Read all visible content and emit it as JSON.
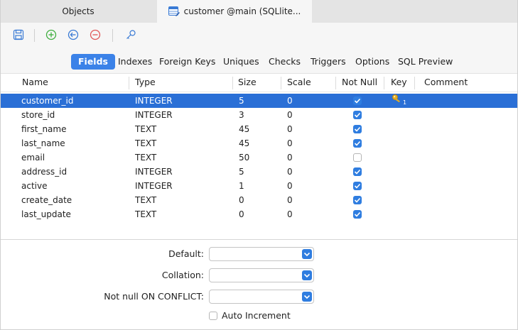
{
  "tabs": {
    "objects": "Objects",
    "active": "customer @main (SQLlite..."
  },
  "toolbar": {
    "icons": [
      "save-icon",
      "add-field-icon",
      "insert-field-icon",
      "delete-field-icon",
      "key-icon"
    ]
  },
  "subtabs": [
    "Fields",
    "Indexes",
    "Foreign Keys",
    "Uniques",
    "Checks",
    "Triggers",
    "Options",
    "SQL Preview"
  ],
  "grid": {
    "headers": {
      "name": "Name",
      "type": "Type",
      "size": "Size",
      "scale": "Scale",
      "not_null": "Not Null",
      "key": "Key",
      "comment": "Comment"
    },
    "rows": [
      {
        "name": "customer_id",
        "type": "INTEGER",
        "size": "5",
        "scale": "0",
        "not_null": true,
        "key": "1",
        "selected": true
      },
      {
        "name": "store_id",
        "type": "INTEGER",
        "size": "3",
        "scale": "0",
        "not_null": true,
        "key": "",
        "selected": false
      },
      {
        "name": "first_name",
        "type": "TEXT",
        "size": "45",
        "scale": "0",
        "not_null": true,
        "key": "",
        "selected": false
      },
      {
        "name": "last_name",
        "type": "TEXT",
        "size": "45",
        "scale": "0",
        "not_null": true,
        "key": "",
        "selected": false
      },
      {
        "name": "email",
        "type": "TEXT",
        "size": "50",
        "scale": "0",
        "not_null": false,
        "key": "",
        "selected": false
      },
      {
        "name": "address_id",
        "type": "INTEGER",
        "size": "5",
        "scale": "0",
        "not_null": true,
        "key": "",
        "selected": false
      },
      {
        "name": "active",
        "type": "INTEGER",
        "size": "1",
        "scale": "0",
        "not_null": true,
        "key": "",
        "selected": false
      },
      {
        "name": "create_date",
        "type": "TEXT",
        "size": "0",
        "scale": "0",
        "not_null": true,
        "key": "",
        "selected": false
      },
      {
        "name": "last_update",
        "type": "TEXT",
        "size": "0",
        "scale": "0",
        "not_null": true,
        "key": "",
        "selected": false
      }
    ]
  },
  "props": {
    "default_label": "Default:",
    "collation_label": "Collation:",
    "not_null_conflict_label": "Not null ON CONFLICT:",
    "auto_increment_label": "Auto Increment",
    "default_value": "",
    "collation_value": "",
    "not_null_conflict_value": ""
  },
  "colors": {
    "accent": "#3b82e8",
    "selection": "#2a6fd6",
    "delete": "#e05555",
    "add": "#3fae3f",
    "key": "#d7a21e"
  }
}
